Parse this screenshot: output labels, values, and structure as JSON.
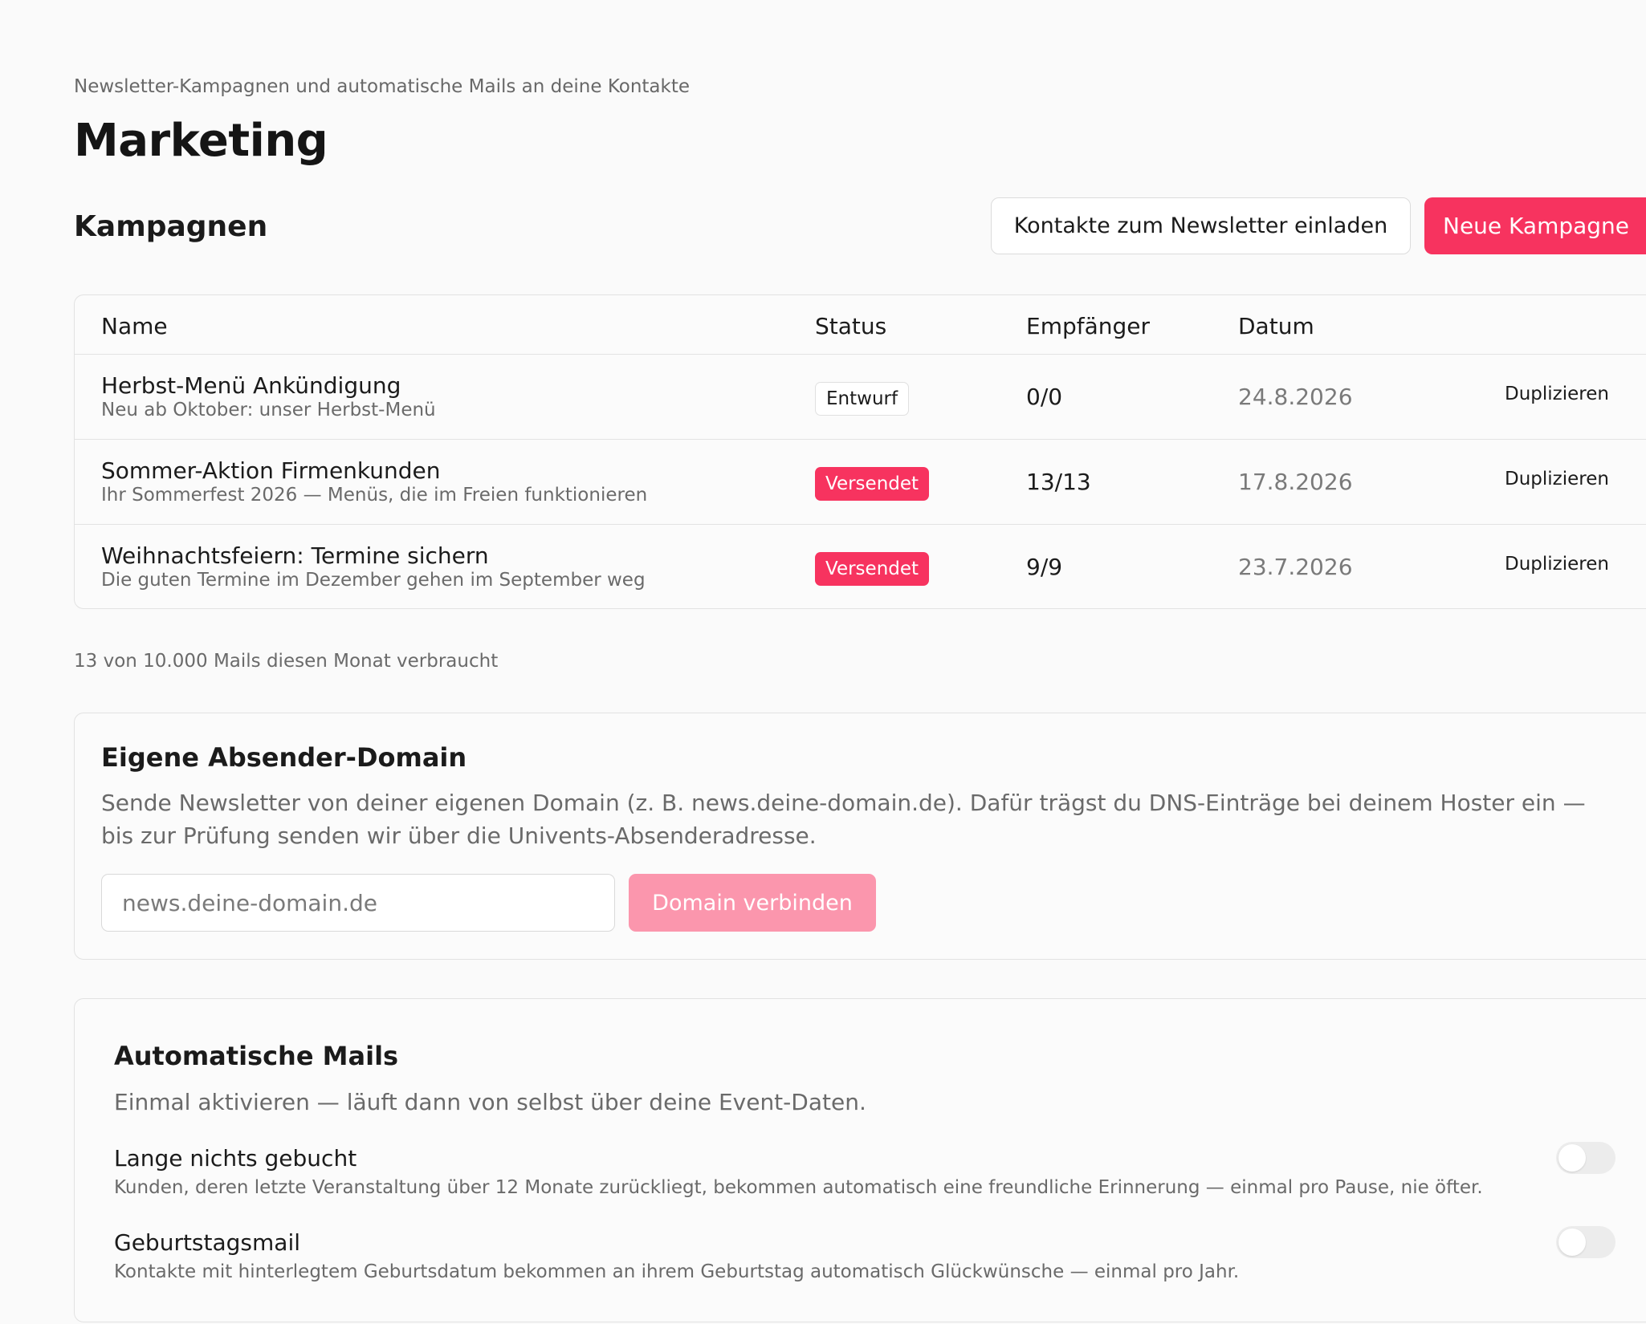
{
  "header": {
    "subtitle": "Newsletter-Kampagnen und automatische Mails an deine Kontakte",
    "title": "Marketing"
  },
  "campaigns": {
    "heading": "Kampagnen",
    "invite_button": "Kontakte zum Newsletter einladen",
    "new_button": "Neue Kampagne",
    "columns": {
      "name": "Name",
      "status": "Status",
      "recipients": "Empfänger",
      "date": "Datum"
    },
    "rows": [
      {
        "name": "Herbst-Menü Ankündigung",
        "subject": "Neu ab Oktober: unser Herbst-Menü",
        "status": "Entwurf",
        "recipients": "0/0",
        "date": "24.8.2026",
        "action": "Duplizieren"
      },
      {
        "name": "Sommer-Aktion Firmenkunden",
        "subject": "Ihr Sommerfest 2026 — Menüs, die im Freien funktionieren",
        "status": "Versendet",
        "recipients": "13/13",
        "date": "17.8.2026",
        "action": "Duplizieren"
      },
      {
        "name": "Weihnachtsfeiern: Termine sichern",
        "subject": "Die guten Termine im Dezember gehen im September weg",
        "status": "Versendet",
        "recipients": "9/9",
        "date": "23.7.2026",
        "action": "Duplizieren"
      }
    ],
    "usage": "13 von 10.000 Mails diesen Monat verbraucht"
  },
  "domain": {
    "title": "Eigene Absender-Domain",
    "description": "Sende Newsletter von deiner eigenen Domain (z. B. news.deine-domain.de). Dafür trägst du DNS-Einträge bei deinem Hoster ein — bis zur Prüfung senden wir über die Univents-Absenderadresse.",
    "input_placeholder": "news.deine-domain.de",
    "input_value": "",
    "connect_button": "Domain verbinden"
  },
  "automation": {
    "title": "Automatische Mails",
    "description": "Einmal aktivieren — läuft dann von selbst über deine Event-Daten.",
    "items": [
      {
        "title": "Lange nichts gebucht",
        "description": "Kunden, deren letzte Veranstaltung über 12 Monate zurückliegt, bekommen automatisch eine freundliche Erinnerung — einmal pro Pause, nie öfter.",
        "enabled": false
      },
      {
        "title": "Geburtstagsmail",
        "description": "Kontakte mit hinterlegtem Geburtsdatum bekommen an ihrem Geburtstag automatisch Glückwünsche — einmal pro Jahr.",
        "enabled": false
      }
    ]
  },
  "colors": {
    "accent": "#f7335f",
    "accent_disabled": "#fb96ad",
    "background": "#fafafa",
    "muted_text": "#6a6a6a"
  }
}
